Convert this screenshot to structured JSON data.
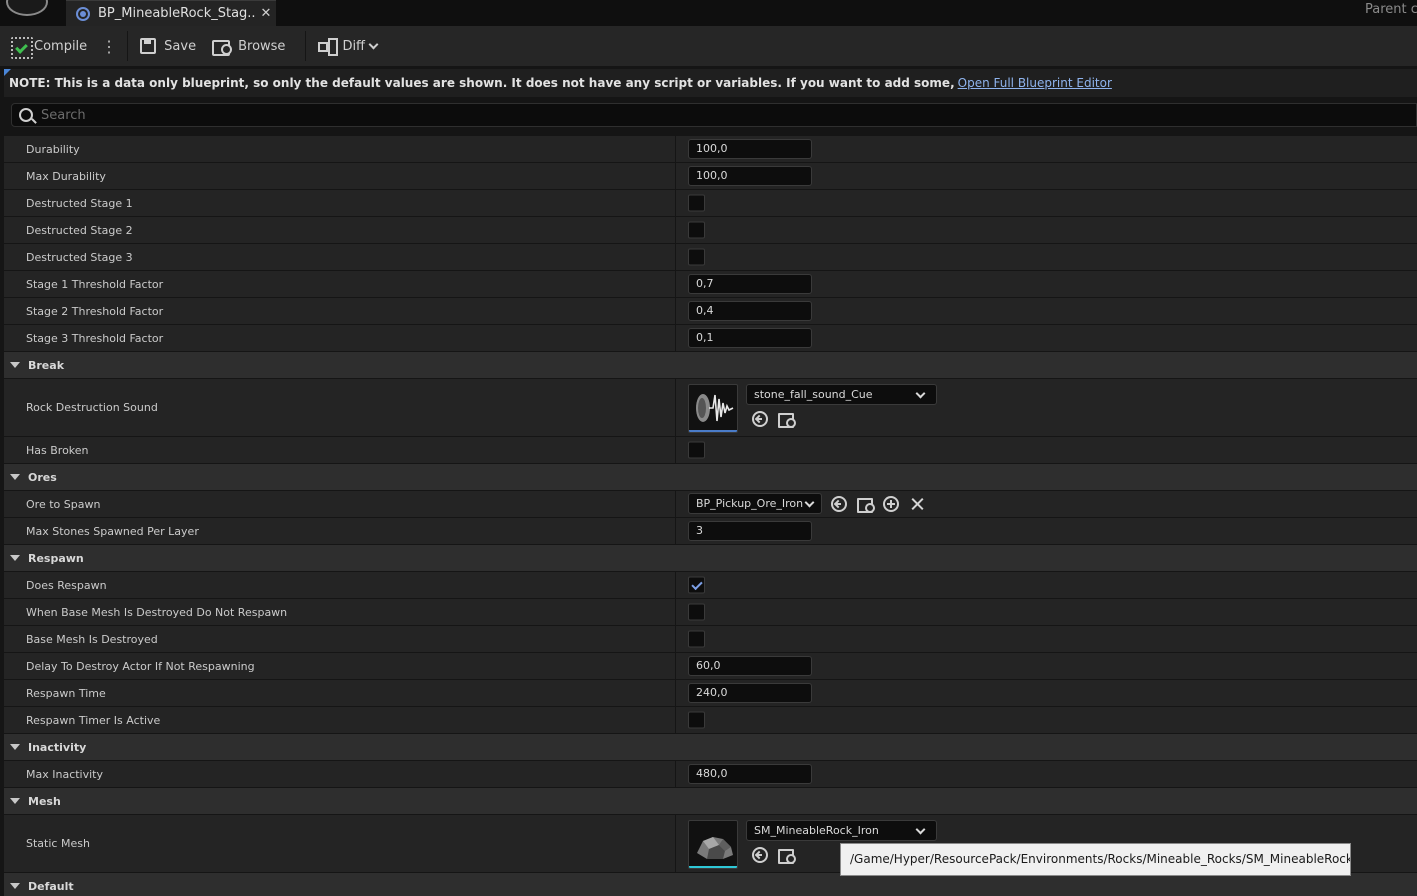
{
  "tab": {
    "title": "BP_MineableRock_Stag...",
    "close": "✕"
  },
  "header": {
    "parent_label": "Parent cl"
  },
  "toolbar": {
    "compile": "Compile",
    "more": "⋮",
    "save": "Save",
    "browse": "Browse",
    "diff": "Diff"
  },
  "note": {
    "text": "NOTE: This is a data only blueprint, so only the default values are shown.  It does not have any script or variables.  If you want to add some,",
    "link": "Open Full Blueprint Editor"
  },
  "search": {
    "placeholder": "Search"
  },
  "props": {
    "durability": {
      "label": "Durability",
      "value": "100,0"
    },
    "max_durability": {
      "label": "Max Durability",
      "value": "100,0"
    },
    "destructed_stage_1": {
      "label": "Destructed Stage 1",
      "checked": false
    },
    "destructed_stage_2": {
      "label": "Destructed Stage 2",
      "checked": false
    },
    "destructed_stage_3": {
      "label": "Destructed Stage 3",
      "checked": false
    },
    "stage_1_threshold": {
      "label": "Stage 1 Threshold Factor",
      "value": "0,7"
    },
    "stage_2_threshold": {
      "label": "Stage 2 Threshold Factor",
      "value": "0,4"
    },
    "stage_3_threshold": {
      "label": "Stage 3 Threshold Factor",
      "value": "0,1"
    },
    "rock_destruction_sound": {
      "label": "Rock Destruction Sound",
      "asset": "stone_fall_sound_Cue"
    },
    "has_broken": {
      "label": "Has Broken",
      "checked": false
    },
    "ore_to_spawn": {
      "label": "Ore to Spawn",
      "asset": "BP_Pickup_Ore_Iron"
    },
    "max_stones_per_layer": {
      "label": "Max Stones Spawned Per Layer",
      "value": "3"
    },
    "does_respawn": {
      "label": "Does Respawn",
      "checked": true
    },
    "base_mesh_no_respawn": {
      "label": "When Base Mesh Is Destroyed Do Not Respawn",
      "checked": false
    },
    "base_mesh_destroyed": {
      "label": "Base Mesh Is Destroyed",
      "checked": false
    },
    "delay_destroy": {
      "label": "Delay To Destroy Actor If Not Respawning",
      "value": "60,0"
    },
    "respawn_time": {
      "label": "Respawn Time",
      "value": "240,0"
    },
    "respawn_timer_active": {
      "label": "Respawn Timer Is Active",
      "checked": false
    },
    "max_inactivity": {
      "label": "Max Inactivity",
      "value": "480,0"
    },
    "static_mesh": {
      "label": "Static Mesh",
      "asset": "SM_MineableRock_Iron"
    }
  },
  "categories": {
    "break": "Break",
    "ores": "Ores",
    "respawn": "Respawn",
    "inactivity": "Inactivity",
    "mesh": "Mesh",
    "default": "Default"
  },
  "tooltip": {
    "text": "/Game/Hyper/ResourcePack/Environments/Rocks/Mineable_Rocks/SM_MineableRock_Iron"
  },
  "colors": {
    "accent": "#4a86d8",
    "link": "#8fb4ee",
    "sound_bar": "#4a7cc9",
    "mesh_bar": "#2ec7d6"
  }
}
